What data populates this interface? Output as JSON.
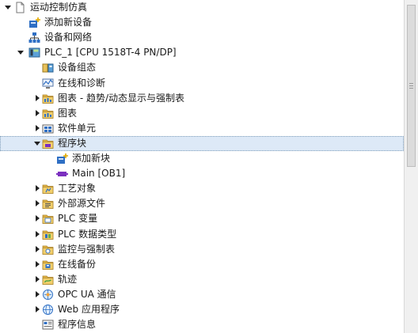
{
  "tree": {
    "items": [
      {
        "label": "运动控制仿真",
        "level": 0,
        "toggle": "expanded",
        "icon": "project-icon"
      },
      {
        "label": "添加新设备",
        "level": 1,
        "toggle": "none",
        "icon": "add-device-icon"
      },
      {
        "label": "设备和网络",
        "level": 1,
        "toggle": "none",
        "icon": "network-icon"
      },
      {
        "label": "PLC_1 [CPU 1518T-4 PN/DP]",
        "level": 1,
        "toggle": "expanded",
        "icon": "plc-icon"
      },
      {
        "label": "设备组态",
        "level": 2,
        "toggle": "none",
        "icon": "device-config-icon"
      },
      {
        "label": "在线和诊断",
        "level": 2,
        "toggle": "none",
        "icon": "online-diagnostics-icon"
      },
      {
        "label": "图表 - 趋势/动态显示与强制表",
        "level": 2,
        "toggle": "collapsed",
        "icon": "folder-chart-icon"
      },
      {
        "label": "图表",
        "level": 2,
        "toggle": "collapsed",
        "icon": "folder-chart-icon"
      },
      {
        "label": "软件单元",
        "level": 2,
        "toggle": "collapsed",
        "icon": "software-units-icon"
      },
      {
        "label": "程序块",
        "level": 2,
        "toggle": "expanded",
        "icon": "folder-blocks-icon",
        "selected": true
      },
      {
        "label": "添加新块",
        "level": 3,
        "toggle": "none",
        "icon": "add-block-icon"
      },
      {
        "label": "Main [OB1]",
        "level": 3,
        "toggle": "none",
        "icon": "ob-block-icon"
      },
      {
        "label": "工艺对象",
        "level": 2,
        "toggle": "collapsed",
        "icon": "folder-tech-icon"
      },
      {
        "label": "外部源文件",
        "level": 2,
        "toggle": "collapsed",
        "icon": "folder-source-icon"
      },
      {
        "label": "PLC 变量",
        "level": 2,
        "toggle": "collapsed",
        "icon": "folder-tags-icon"
      },
      {
        "label": "PLC 数据类型",
        "level": 2,
        "toggle": "collapsed",
        "icon": "folder-datatype-icon"
      },
      {
        "label": "监控与强制表",
        "level": 2,
        "toggle": "collapsed",
        "icon": "folder-watch-icon"
      },
      {
        "label": "在线备份",
        "level": 2,
        "toggle": "collapsed",
        "icon": "folder-backup-icon"
      },
      {
        "label": "轨迹",
        "level": 2,
        "toggle": "collapsed",
        "icon": "folder-trace-icon"
      },
      {
        "label": "OPC UA 通信",
        "level": 2,
        "toggle": "collapsed",
        "icon": "opcua-icon"
      },
      {
        "label": "Web 应用程序",
        "level": 2,
        "toggle": "collapsed",
        "icon": "web-app-icon"
      },
      {
        "label": "程序信息",
        "level": 2,
        "toggle": "none",
        "icon": "program-info-icon"
      }
    ]
  },
  "colors": {
    "selection_bg": "#dde9f7",
    "folder": "#e3b545",
    "accent_blue": "#2f6fc4",
    "block_purple": "#7b2fbf"
  }
}
